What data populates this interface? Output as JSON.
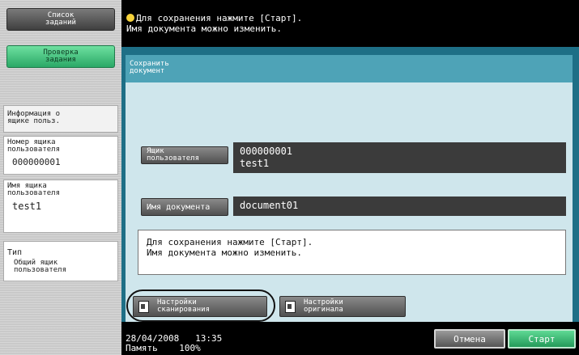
{
  "sidebar": {
    "jobs_list_label": "Список\nзаданий",
    "check_job_label": "Проверка\nзадания",
    "user_box_info_label": "Информация о\nящике польз.",
    "box_number_label": "Номер ящика\nпользователя",
    "box_number_value": "000000001",
    "box_name_label": "Имя ящика\nпользователя",
    "box_name_value": "test1",
    "type_label": "Тип",
    "type_value": "Общий ящик\nпользователя"
  },
  "top_message": "Для сохранения нажмите [Старт].\nИмя документа можно изменить.",
  "panel": {
    "title": "Сохранить\nдокумент",
    "user_box_button": "Ящик\nпользователя",
    "user_box_value": "000000001\ntest1",
    "doc_name_button": "Имя документа",
    "doc_name_value": "document01",
    "message": "Для сохранения нажмите [Старт].\nИмя документа можно изменить.",
    "scan_settings_button": "Настройки\nсканирования",
    "original_settings_button": "Настройки\nоригинала"
  },
  "bottom": {
    "date": "28/04/2008",
    "time": "13:35",
    "memory_label": "Память",
    "memory_value": "100%",
    "cancel_label": "Отмена",
    "start_label": "Старт"
  },
  "colors": {
    "frame": "#1e6f86",
    "title_strip": "#4ea3b7",
    "panel": "#cfe6ec",
    "start_green": "#2aa866"
  },
  "icons": {
    "top_message": "lightbulb-icon",
    "scan_settings": "scan-settings-icon",
    "original_settings": "original-settings-icon"
  }
}
